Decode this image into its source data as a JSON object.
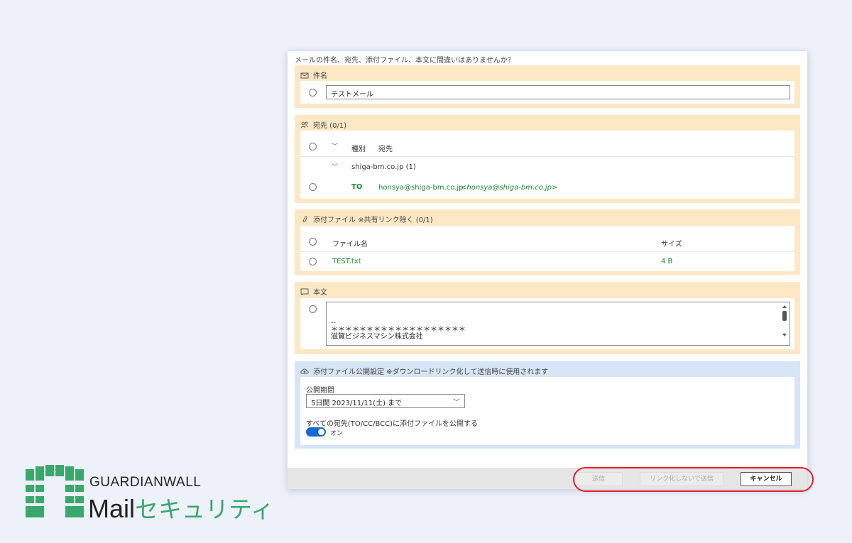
{
  "question": "メールの件名、宛先、添付ファイル、本文に間違いはありませんか？",
  "subject": {
    "header": "件名",
    "value": "テストメール"
  },
  "recipients": {
    "header": "宛先 (0/1)",
    "col_type": "種別",
    "col_dest": "宛先",
    "domain_group": "shiga-bm.co.jp (1)",
    "rows": [
      {
        "type": "TO",
        "address": "honsya@shiga-bm.co.jp",
        "display": "<honsya@shiga-bm.co.jp>"
      }
    ]
  },
  "attachments": {
    "header": "添付ファイル ※共有リンク除く (0/1)",
    "col_name": "ファイル名",
    "col_size": "サイズ",
    "rows": [
      {
        "name": "TEST.txt",
        "size": "4 B"
      }
    ]
  },
  "body": {
    "header": "本文",
    "lines": [
      "--",
      "＊＊＊＊＊＊＊＊＊＊＊＊＊＊＊＊＊＊＊",
      "滋賀ビジネスマシン株式会社"
    ]
  },
  "publish": {
    "header": "添付ファイル公開設定 ※ダウンロードリンク化して送信時に使用されます",
    "period_label": "公開期間",
    "period_value": "5日間 2023/11/11(土) まで",
    "all_label": "すべての宛先(TO/CC/BCC)に添付ファイルを公開する",
    "toggle_label": "オン",
    "toggle_on": true
  },
  "buttons": {
    "send": "送信",
    "send_nolink": "リンク化しないで送信",
    "cancel": "キャンセル"
  },
  "logo": {
    "brand": "GUARDIANWALL",
    "product_latin": "Mail",
    "product_kana": "セキュリティ"
  },
  "colors": {
    "section_orange": "#fde8c6",
    "section_blue": "#d6e6f7",
    "accent_green": "#1b8a2f",
    "toggle_blue": "#1769d3",
    "highlight_red": "#e0202a",
    "logo_green": "#3aa86b"
  }
}
